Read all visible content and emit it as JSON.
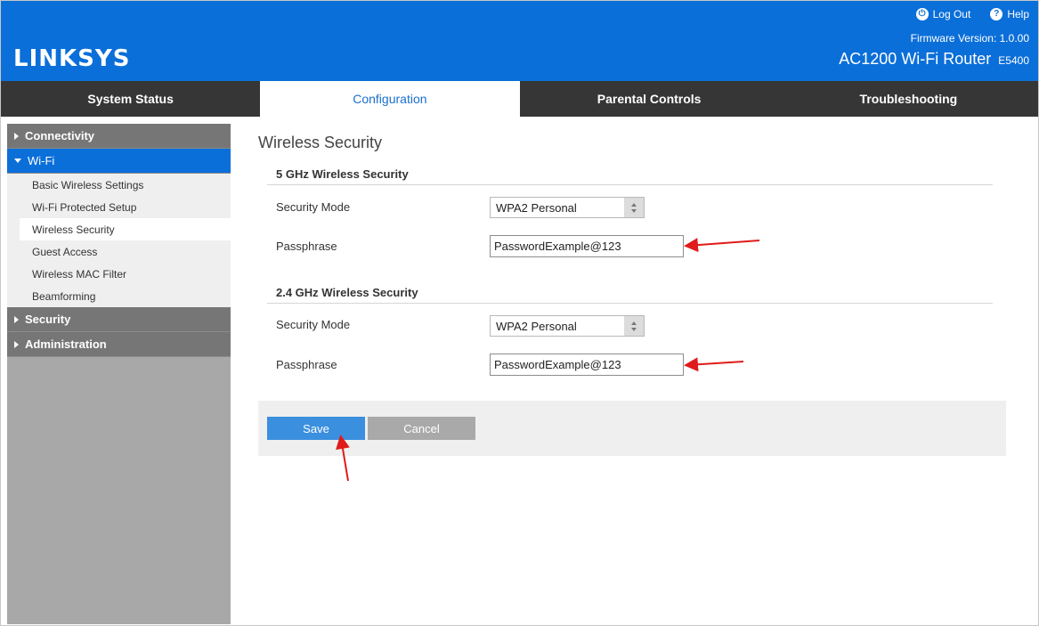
{
  "header": {
    "brand": "LINKSYS",
    "logout_label": "Log Out",
    "help_label": "Help",
    "firmware_label": "Firmware Version: 1.0.00",
    "model_name": "AC1200 Wi-Fi Router",
    "model_code": "E5400"
  },
  "nav": {
    "tabs": [
      {
        "label": "System Status"
      },
      {
        "label": "Configuration"
      },
      {
        "label": "Parental Controls"
      },
      {
        "label": "Troubleshooting"
      }
    ]
  },
  "sidebar": {
    "connectivity": "Connectivity",
    "wifi": "Wi-Fi",
    "wifi_items": [
      {
        "label": "Basic Wireless Settings"
      },
      {
        "label": "Wi-Fi Protected Setup"
      },
      {
        "label": "Wireless Security"
      },
      {
        "label": "Guest Access"
      },
      {
        "label": "Wireless MAC Filter"
      },
      {
        "label": "Beamforming"
      }
    ],
    "security": "Security",
    "administration": "Administration"
  },
  "main": {
    "page_title": "Wireless Security",
    "band_5": {
      "title": "5 GHz Wireless Security",
      "mode_label": "Security Mode",
      "mode_value": "WPA2 Personal",
      "passphrase_label": "Passphrase",
      "passphrase_value": "PasswordExample@123"
    },
    "band_24": {
      "title": "2.4 GHz Wireless Security",
      "mode_label": "Security Mode",
      "mode_value": "WPA2 Personal",
      "passphrase_label": "Passphrase",
      "passphrase_value": "PasswordExample@123"
    },
    "save_label": "Save",
    "cancel_label": "Cancel"
  },
  "colors": {
    "brand_blue": "#0b6fd9",
    "nav_dark": "#363636",
    "save_blue": "#3b8fdf",
    "annotation_red": "#e01b1b"
  }
}
